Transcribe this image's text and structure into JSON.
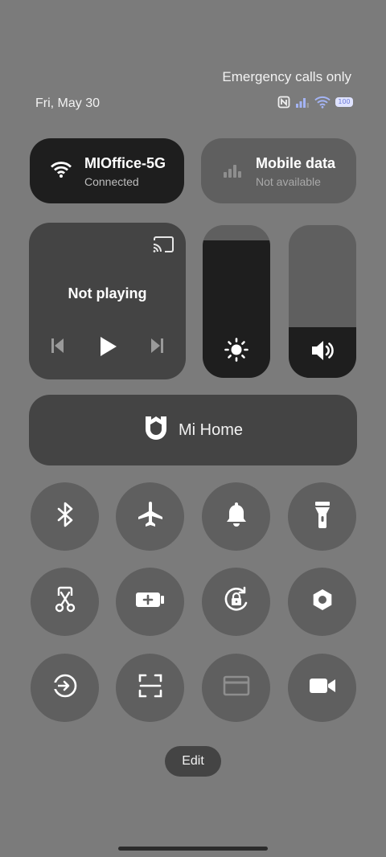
{
  "status": {
    "emergency": "Emergency calls only",
    "date": "Fri, May 30",
    "battery": "100",
    "icons": [
      "nfc-icon",
      "signal-icon",
      "wifi-icon",
      "battery-icon"
    ]
  },
  "tiles": {
    "wifi": {
      "title": "MIOffice-5G",
      "subtitle": "Connected",
      "icon": "wifi-icon",
      "active": true
    },
    "mobile": {
      "title": "Mobile data",
      "subtitle": "Not available",
      "icon": "signal-icon",
      "active": false
    }
  },
  "media": {
    "title": "Not playing",
    "icons": [
      "cast-icon",
      "previous-icon",
      "play-icon",
      "next-icon"
    ]
  },
  "sliders": {
    "brightness": {
      "level": 0.9,
      "icon": "brightness-icon"
    },
    "volume": {
      "level": 0.33,
      "icon": "volume-icon"
    }
  },
  "mi_home": {
    "label": "Mi Home",
    "icon": "mi-home-icon"
  },
  "toggles": [
    "bluetooth-icon",
    "airplane-icon",
    "bell-icon",
    "flashlight-icon",
    "screenshot-icon",
    "battery-saver-icon",
    "rotation-lock-icon",
    "settings-icon",
    "sync-icon",
    "scan-icon",
    "card-icon",
    "video-icon"
  ],
  "edit": {
    "label": "Edit"
  },
  "colors": {
    "background": "#7b7b7b",
    "active_tile": "#1e1e1e",
    "inactive_tile": "#5f5f5f",
    "panel": "#444444"
  }
}
